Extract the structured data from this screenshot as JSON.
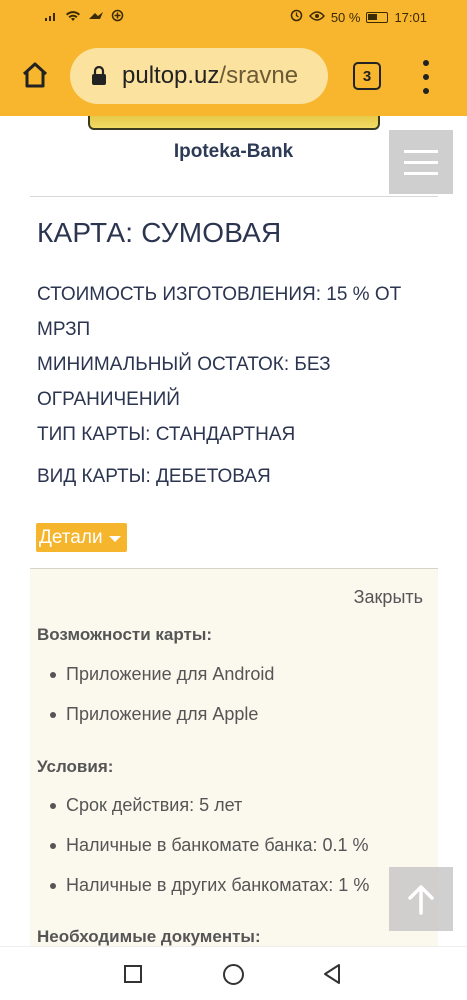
{
  "status_bar": {
    "battery": "50 %",
    "time": "17:01"
  },
  "browser": {
    "url_domain": "pultop.uz",
    "url_path": "/sravne",
    "tab_count": "3"
  },
  "page": {
    "bank_name": "Ipoteka-Bank",
    "card_title": "КАРТА: СУМОВАЯ",
    "specs": {
      "cost_line1": "СТОИМОСТЬ ИЗГОТОВЛЕНИЯ: 15 % ОТ",
      "cost_line2": "МРЗП",
      "min_line1": "МИНИМАЛЬНЫЙ ОСТАТОК: БЕЗ",
      "min_line2": "ОГРАНИЧЕНИЙ",
      "type": "ТИП КАРТЫ: СТАНДАРТНАЯ",
      "kind": "ВИД КАРТЫ: ДЕБЕТОВАЯ"
    },
    "details_label": "Детали",
    "details": {
      "close_label": "Закрыть",
      "features_title": "Возможности карты:",
      "features": [
        "Приложение для Android",
        "Приложение для Apple"
      ],
      "conditions_title": "Условия:",
      "conditions": [
        "Срок действия: 5 лет",
        "Наличные в банкомате банка: 0.1 %",
        "Наличные в других банкоматах: 1 %"
      ],
      "documents_title": "Необходимые документы:"
    }
  },
  "colors": {
    "toolbar": "#f8b52e",
    "accent": "#f5b52c",
    "heading": "#2c3550"
  }
}
